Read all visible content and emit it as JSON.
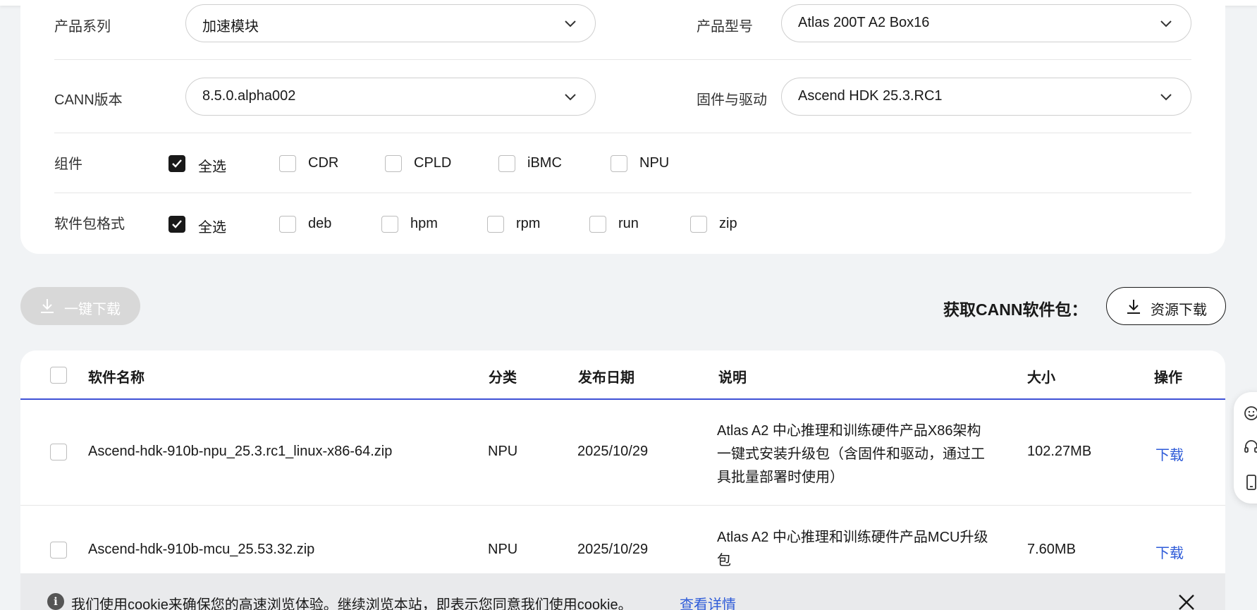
{
  "filters": {
    "series": {
      "label": "产品系列",
      "value": "加速模块"
    },
    "model": {
      "label": "产品型号",
      "value": "Atlas 200T A2 Box16"
    },
    "cann": {
      "label": "CANN版本",
      "value": "8.5.0.alpha002"
    },
    "firmware": {
      "label": "固件与驱动",
      "value": "Ascend HDK 25.3.RC1"
    },
    "components": {
      "label": "组件",
      "options": [
        {
          "label": "全选",
          "checked": true
        },
        {
          "label": "CDR",
          "checked": false
        },
        {
          "label": "CPLD",
          "checked": false
        },
        {
          "label": "iBMC",
          "checked": false
        },
        {
          "label": "NPU",
          "checked": false
        }
      ]
    },
    "formats": {
      "label": "软件包格式",
      "options": [
        {
          "label": "全选",
          "checked": true
        },
        {
          "label": "deb",
          "checked": false
        },
        {
          "label": "hpm",
          "checked": false
        },
        {
          "label": "rpm",
          "checked": false
        },
        {
          "label": "run",
          "checked": false
        },
        {
          "label": "zip",
          "checked": false
        }
      ]
    }
  },
  "actions": {
    "batch_download": "一键下载",
    "get_cann": "获取CANN软件包：",
    "resource_download": "资源下载"
  },
  "table": {
    "headers": {
      "name": "软件名称",
      "category": "分类",
      "date": "发布日期",
      "desc": "说明",
      "size": "大小",
      "op": "操作"
    },
    "rows": [
      {
        "name": "Ascend-hdk-910b-npu_25.3.rc1_linux-x86-64.zip",
        "category": "NPU",
        "date": "2025/10/29",
        "desc_lines": [
          "Atlas A2 中心推理和训练硬件产品X86架构",
          "一键式安装升级包（含固件和驱动，通过工",
          "具批量部署时使用）"
        ],
        "size": "102.27MB",
        "op": "下载"
      },
      {
        "name": "Ascend-hdk-910b-mcu_25.53.32.zip",
        "category": "NPU",
        "date": "2025/10/29",
        "desc_lines": [
          "Atlas A2 中心推理和训练硬件产品MCU升级",
          "包"
        ],
        "size": "7.60MB",
        "op": "下载"
      }
    ]
  },
  "cookie": {
    "message": "我们使用cookie来确保您的高速浏览体验。继续浏览本站，即表示您同意我们使用cookie。",
    "link": "查看详情"
  },
  "colors": {
    "accent_blue": "#3f51d6",
    "link": "#2e5bd8",
    "checked": "#191919"
  }
}
